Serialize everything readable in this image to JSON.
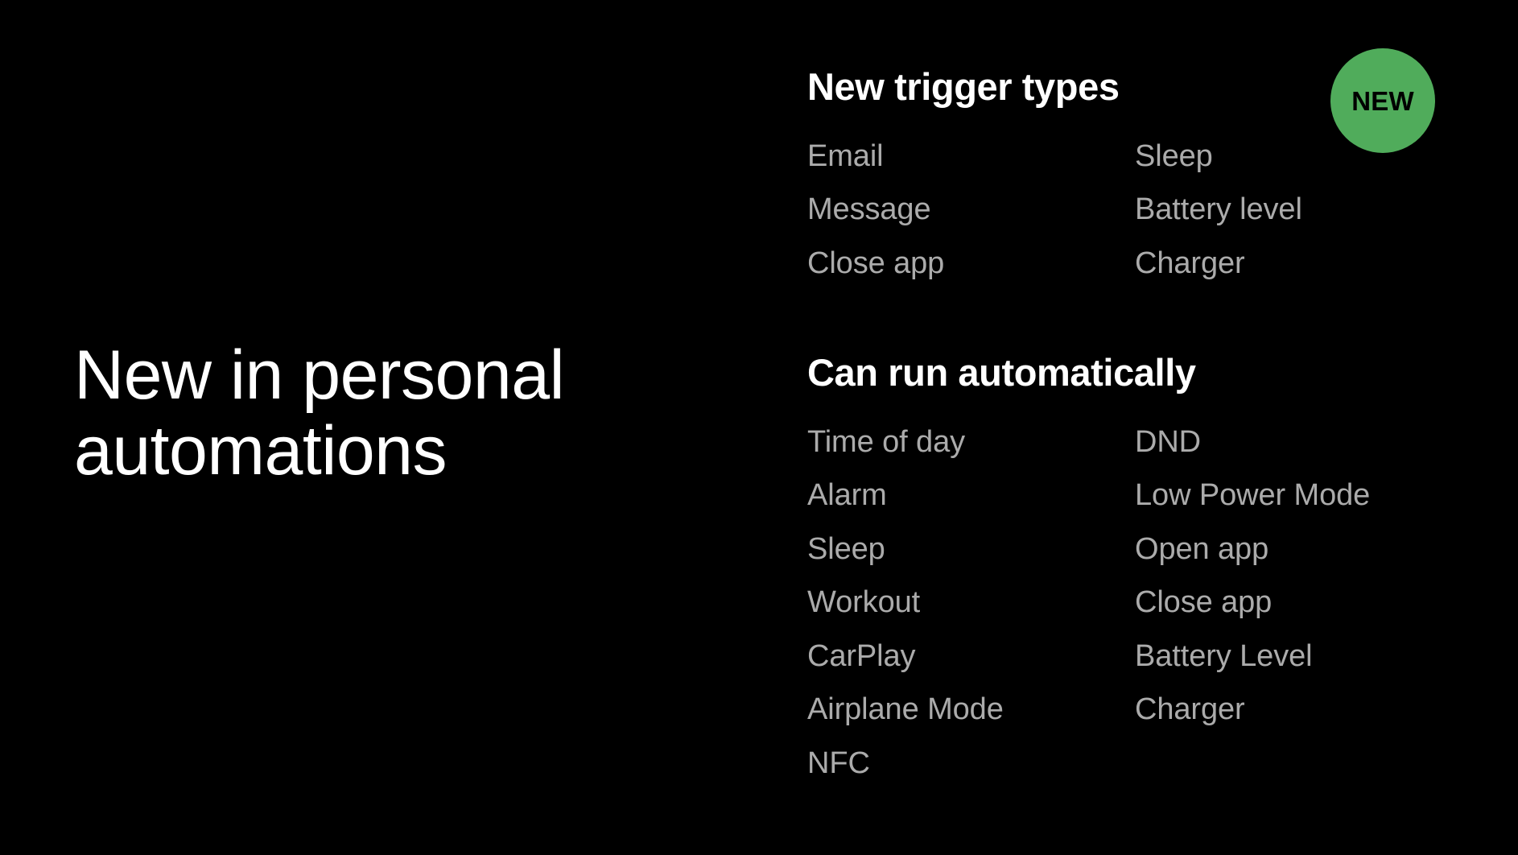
{
  "slide": {
    "background_color": "#000000",
    "title_lines": "New in personal\nautomations",
    "title_color": "#ffffff"
  },
  "badge": {
    "label": "NEW",
    "fill_color": "#50ac5b",
    "text_color": "#000000"
  },
  "sections": [
    {
      "heading": "New trigger types",
      "heading_color": "#ffffff",
      "item_color": "#ababab",
      "columns": [
        {
          "items": [
            "Email",
            "Message",
            "Close app"
          ]
        },
        {
          "items": [
            "Sleep",
            "Battery level",
            "Charger"
          ]
        }
      ]
    },
    {
      "heading": "Can run automatically",
      "heading_color": "#ffffff",
      "item_color": "#ababab",
      "columns": [
        {
          "items": [
            "Time of day",
            "Alarm",
            "Sleep",
            "Workout",
            "CarPlay",
            "Airplane Mode",
            "NFC"
          ]
        },
        {
          "items": [
            "DND",
            "Low Power Mode",
            "Open app",
            "Close app",
            "Battery Level",
            "Charger"
          ]
        }
      ]
    }
  ]
}
